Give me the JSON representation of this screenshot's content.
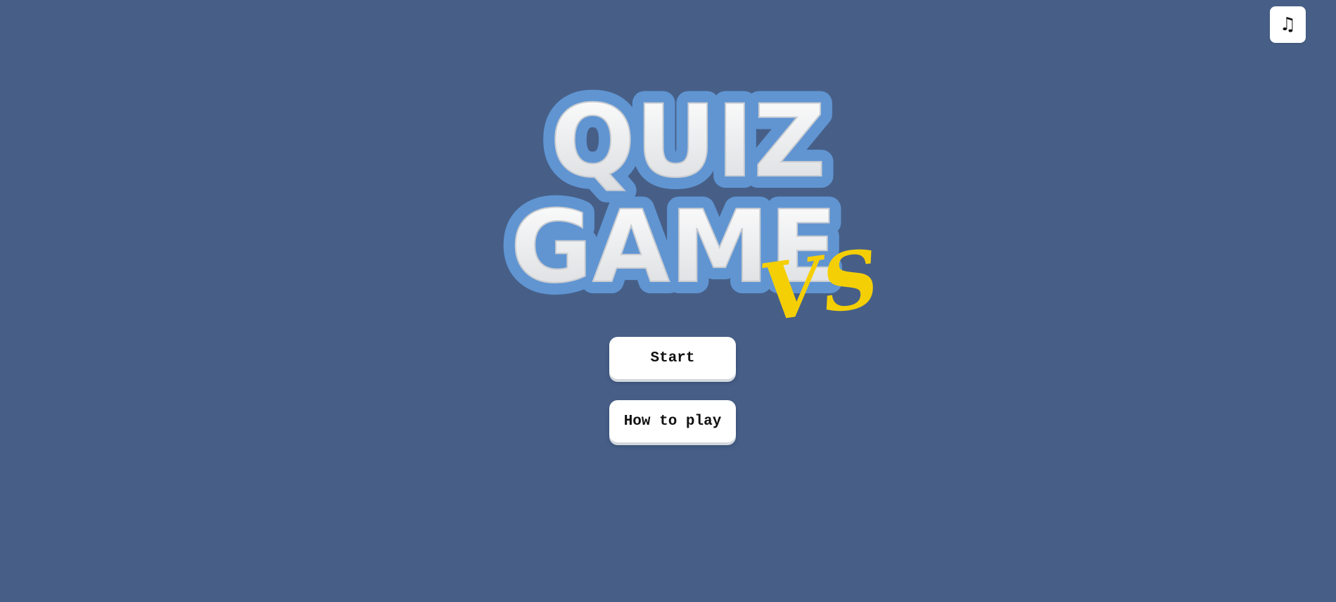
{
  "app": {
    "background_color": "#475f87"
  },
  "music_toggle": {
    "icon": "music-note-icon",
    "glyph": "♫"
  },
  "logo": {
    "line1": "QUIZ",
    "line2": "GAME",
    "vs": "VS",
    "colors": {
      "outline": "#6095d2",
      "letters": "#ececec",
      "vs": "#f5cf05"
    }
  },
  "menu": {
    "start_label": "Start",
    "howto_label": "How to play"
  }
}
